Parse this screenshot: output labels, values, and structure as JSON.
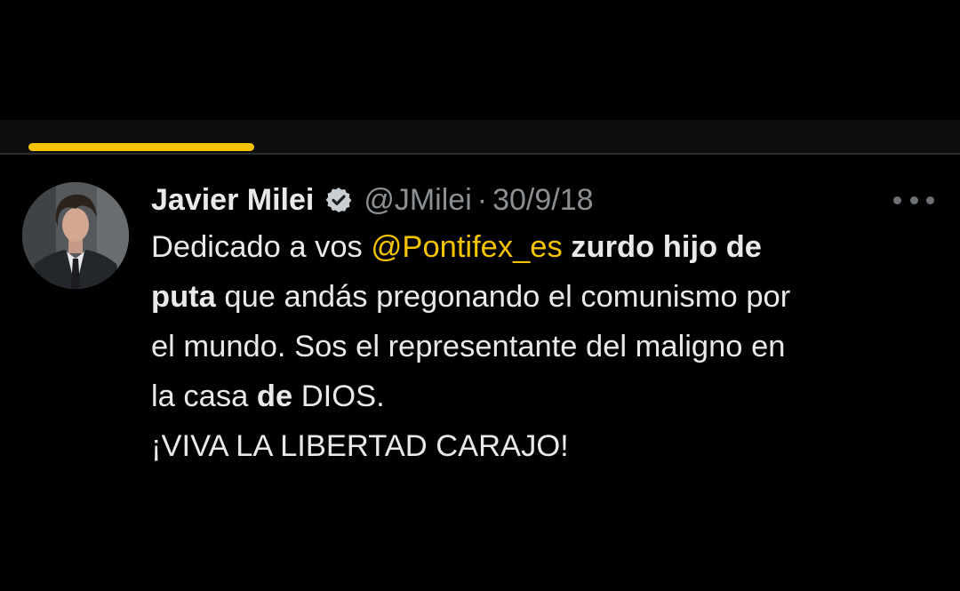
{
  "tweet": {
    "author_name": "Javier Milei",
    "handle": "@JMilei",
    "separator": "·",
    "date": "30/9/18",
    "verified": true,
    "icons": {
      "verified": "verified-badge-icon",
      "more": "more-options-icon"
    },
    "body": {
      "l1_a": "Dedicado a vos ",
      "l1_mention": "@Pontifex_es",
      "l1_b": " zurdo hijo de",
      "l2_a": "puta",
      "l2_b": " que andás pregonando el comunismo por",
      "l3": "el mundo. Sos el representante del maligno en",
      "l4_a": "la casa ",
      "l4_b": "de",
      "l4_c": " DIOS.",
      "l5": "¡VIVA LA LIBERTAD CARAJO!"
    }
  },
  "colors": {
    "background": "#000000",
    "text": "#e7e9ea",
    "muted": "#8b9094",
    "accent": "#f5c400"
  }
}
